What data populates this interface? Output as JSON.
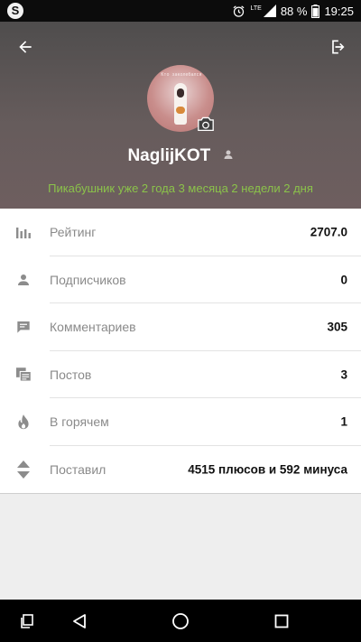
{
  "status_bar": {
    "network_label": "LTE",
    "battery_percent": "88 %",
    "battery_level": 0.88,
    "time": "19:25",
    "notification_app": "skype-icon",
    "skype_glyph": "S"
  },
  "header": {
    "back_icon": "arrow-back-icon",
    "logout_icon": "logout-icon",
    "avatar_caption": "Кто заколебался",
    "camera_icon": "camera-icon",
    "username": "NaglijKOT",
    "tenure": "Пикабушник уже 2 года 3 месяца 2 недели 2 дня"
  },
  "stats": [
    {
      "icon": "bar-chart-icon",
      "label": "Рейтинг",
      "value": "2707.0"
    },
    {
      "icon": "person-icon",
      "label": "Подписчиков",
      "value": "0"
    },
    {
      "icon": "comment-icon",
      "label": "Комментариев",
      "value": "305"
    },
    {
      "icon": "posts-icon",
      "label": "Постов",
      "value": "3"
    },
    {
      "icon": "fire-icon",
      "label": "В горячем",
      "value": "1"
    },
    {
      "icon": "vote-arrows-icon",
      "label": "Поставил",
      "value": "4515 плюсов и 592 минуса"
    }
  ],
  "colors": {
    "header_bg": "#5e5757",
    "tenure_text": "#8bc34a",
    "list_bg": "#ffffff",
    "page_bg": "#eeeeee",
    "nav_bg": "#000000"
  },
  "navbar": {
    "buttons": [
      "recent-apps-icon",
      "back-triangle-icon",
      "home-circle-icon",
      "overview-square-icon"
    ]
  }
}
